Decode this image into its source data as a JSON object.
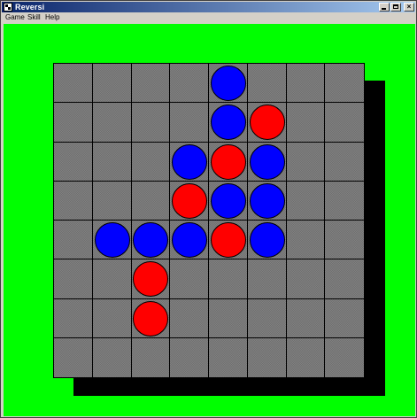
{
  "window": {
    "title": "Reversi"
  },
  "menu": [
    "Game",
    "Skill",
    "Help"
  ],
  "caption_buttons": {
    "minimize": "_",
    "maximize": "□",
    "close": "×"
  },
  "colors": {
    "background": "#00ff00",
    "board": "#808080",
    "blue": "#0000ff",
    "red": "#ff0000"
  },
  "board": {
    "size": 8,
    "discs": [
      {
        "row": 0,
        "col": 4,
        "color": "blue"
      },
      {
        "row": 1,
        "col": 4,
        "color": "blue"
      },
      {
        "row": 1,
        "col": 5,
        "color": "red"
      },
      {
        "row": 2,
        "col": 3,
        "color": "blue"
      },
      {
        "row": 2,
        "col": 4,
        "color": "red"
      },
      {
        "row": 2,
        "col": 5,
        "color": "blue"
      },
      {
        "row": 3,
        "col": 3,
        "color": "red"
      },
      {
        "row": 3,
        "col": 4,
        "color": "blue"
      },
      {
        "row": 3,
        "col": 5,
        "color": "blue"
      },
      {
        "row": 4,
        "col": 1,
        "color": "blue"
      },
      {
        "row": 4,
        "col": 2,
        "color": "blue"
      },
      {
        "row": 4,
        "col": 3,
        "color": "blue"
      },
      {
        "row": 4,
        "col": 4,
        "color": "red"
      },
      {
        "row": 4,
        "col": 5,
        "color": "blue"
      },
      {
        "row": 5,
        "col": 2,
        "color": "red"
      },
      {
        "row": 6,
        "col": 2,
        "color": "red"
      }
    ]
  }
}
